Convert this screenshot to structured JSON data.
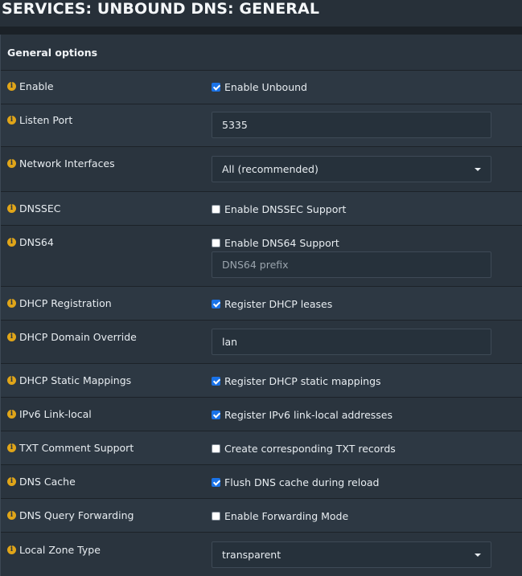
{
  "page": {
    "title": "SERVICES: UNBOUND DNS: GENERAL"
  },
  "section": {
    "title": "General options"
  },
  "rows": [
    {
      "label": "Enable",
      "control": "checkbox",
      "checked": true,
      "text": "Enable Unbound"
    },
    {
      "label": "Listen Port",
      "control": "input",
      "value": "5335"
    },
    {
      "label": "Network Interfaces",
      "control": "select",
      "value": "All (recommended)"
    },
    {
      "label": "DNSSEC",
      "control": "checkbox",
      "checked": false,
      "text": "Enable DNSSEC Support"
    },
    {
      "label": "DNS64",
      "control": "checkbox",
      "checked": false,
      "text": "Enable DNS64 Support",
      "extra_placeholder": "DNS64 prefix"
    },
    {
      "label": "DHCP Registration",
      "control": "checkbox",
      "checked": true,
      "text": "Register DHCP leases"
    },
    {
      "label": "DHCP Domain Override",
      "control": "input",
      "value": "lan"
    },
    {
      "label": "DHCP Static Mappings",
      "control": "checkbox",
      "checked": true,
      "text": "Register DHCP static mappings"
    },
    {
      "label": "IPv6 Link-local",
      "control": "checkbox",
      "checked": true,
      "text": "Register IPv6 link-local addresses"
    },
    {
      "label": "TXT Comment Support",
      "control": "checkbox",
      "checked": false,
      "text": "Create corresponding TXT records"
    },
    {
      "label": "DNS Cache",
      "control": "checkbox",
      "checked": true,
      "text": "Flush DNS cache during reload"
    },
    {
      "label": "DNS Query Forwarding",
      "control": "checkbox",
      "checked": false,
      "text": "Enable Forwarding Mode"
    },
    {
      "label": "Local Zone Type",
      "control": "select",
      "value": "transparent"
    }
  ],
  "icons": {
    "info": "info-icon"
  },
  "colors": {
    "info_icon": "#e0a519",
    "checkbox_checked": "#1a73e8"
  }
}
